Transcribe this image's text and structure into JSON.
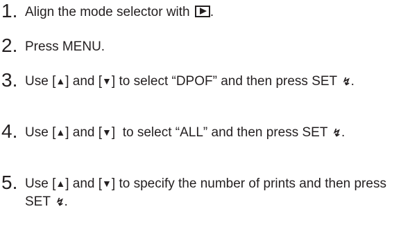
{
  "steps": [
    {
      "number": "1.",
      "text_before": "Align the mode selector with",
      "icon": "play-mode-icon",
      "text_after": "."
    },
    {
      "number": "2.",
      "text": "Press MENU."
    },
    {
      "number": "3.",
      "text_part1": "Use [",
      "up": "▲",
      "text_part2": "] and [",
      "down": "▼",
      "text_part3": "] to select “DPOF” and then press SET",
      "bolt": "↯",
      "text_end": "."
    },
    {
      "number": "4.",
      "text_part1": "Use [",
      "up": "▲",
      "text_part2": "] and [",
      "down": "▼",
      "text_part3": "]  to select “ALL” and then press SET",
      "bolt": "↯",
      "text_end": "."
    },
    {
      "number": "5.",
      "text_part1": "Use [",
      "up": "▲",
      "text_part2": "] and [",
      "down": "▼",
      "text_part3": "] to specify the number of prints and then press SET",
      "bolt": "↯",
      "text_end": "."
    }
  ]
}
